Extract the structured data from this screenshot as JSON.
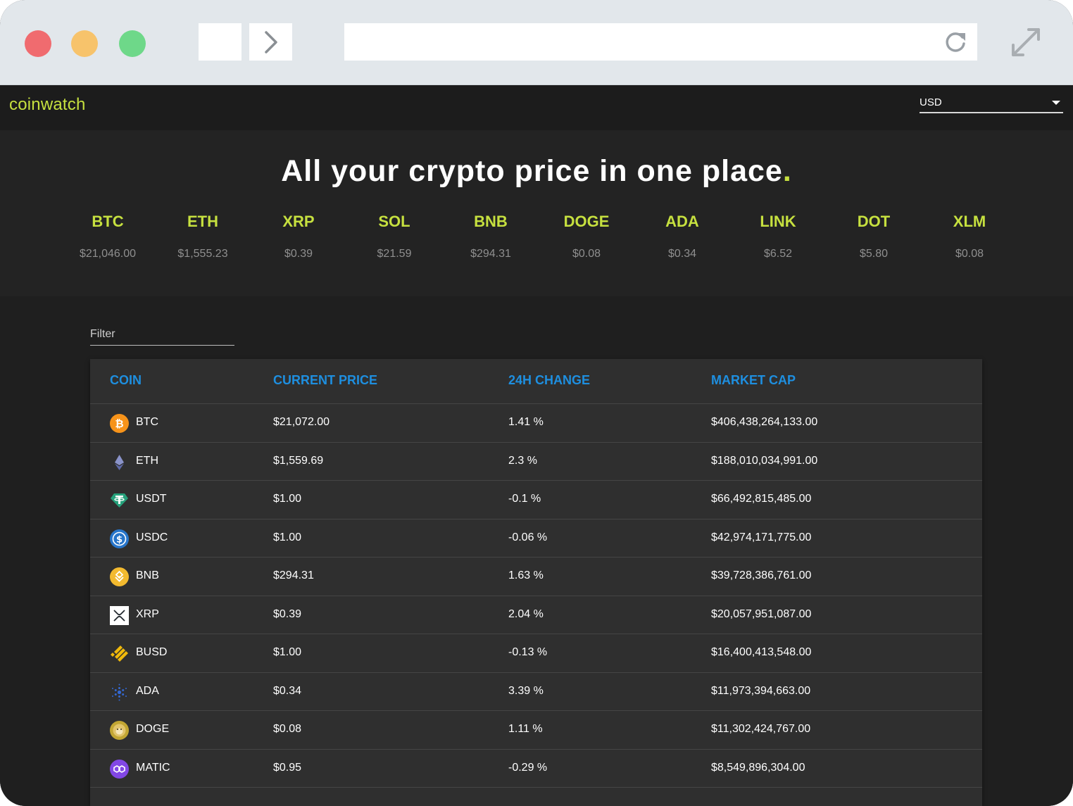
{
  "app": {
    "brand": "coinwatch",
    "currency": "USD"
  },
  "hero": {
    "title": "All your crypto price in one place",
    "period": "."
  },
  "tickers": [
    {
      "symbol": "BTC",
      "price": "$21,046.00"
    },
    {
      "symbol": "ETH",
      "price": "$1,555.23"
    },
    {
      "symbol": "XRP",
      "price": "$0.39"
    },
    {
      "symbol": "SOL",
      "price": "$21.59"
    },
    {
      "symbol": "BNB",
      "price": "$294.31"
    },
    {
      "symbol": "DOGE",
      "price": "$0.08"
    },
    {
      "symbol": "ADA",
      "price": "$0.34"
    },
    {
      "symbol": "LINK",
      "price": "$6.52"
    },
    {
      "symbol": "DOT",
      "price": "$5.80"
    },
    {
      "symbol": "XLM",
      "price": "$0.08"
    }
  ],
  "filter": {
    "label": "Filter"
  },
  "table": {
    "headers": {
      "coin": "COIN",
      "price": "CURRENT PRICE",
      "change": "24H CHANGE",
      "cap": "MARKET CAP"
    },
    "rows": [
      {
        "coin": "BTC",
        "icon": "bitcoin-icon",
        "price": "$21,072.00",
        "change": "1.41 %",
        "cap": "$406,438,264,133.00"
      },
      {
        "coin": "ETH",
        "icon": "ethereum-icon",
        "price": "$1,559.69",
        "change": "2.3 %",
        "cap": "$188,010,034,991.00"
      },
      {
        "coin": "USDT",
        "icon": "tether-icon",
        "price": "$1.00",
        "change": "-0.1 %",
        "cap": "$66,492,815,485.00"
      },
      {
        "coin": "USDC",
        "icon": "usd-coin-icon",
        "price": "$1.00",
        "change": "-0.06 %",
        "cap": "$42,974,171,775.00"
      },
      {
        "coin": "BNB",
        "icon": "bnb-icon",
        "price": "$294.31",
        "change": "1.63 %",
        "cap": "$39,728,386,761.00"
      },
      {
        "coin": "XRP",
        "icon": "xrp-icon",
        "price": "$0.39",
        "change": "2.04 %",
        "cap": "$20,057,951,087.00"
      },
      {
        "coin": "BUSD",
        "icon": "busd-icon",
        "price": "$1.00",
        "change": "-0.13 %",
        "cap": "$16,400,413,548.00"
      },
      {
        "coin": "ADA",
        "icon": "cardano-icon",
        "price": "$0.34",
        "change": "3.39 %",
        "cap": "$11,973,394,663.00"
      },
      {
        "coin": "DOGE",
        "icon": "dogecoin-icon",
        "price": "$0.08",
        "change": "1.11 %",
        "cap": "$11,302,424,767.00"
      },
      {
        "coin": "MATIC",
        "icon": "polygon-icon",
        "price": "$0.95",
        "change": "-0.29 %",
        "cap": "$8,549,896,304.00"
      }
    ]
  },
  "colors": {
    "accent": "#c6e03f",
    "header_blue": "#1e8fe0",
    "background": "#1f1f1f"
  }
}
